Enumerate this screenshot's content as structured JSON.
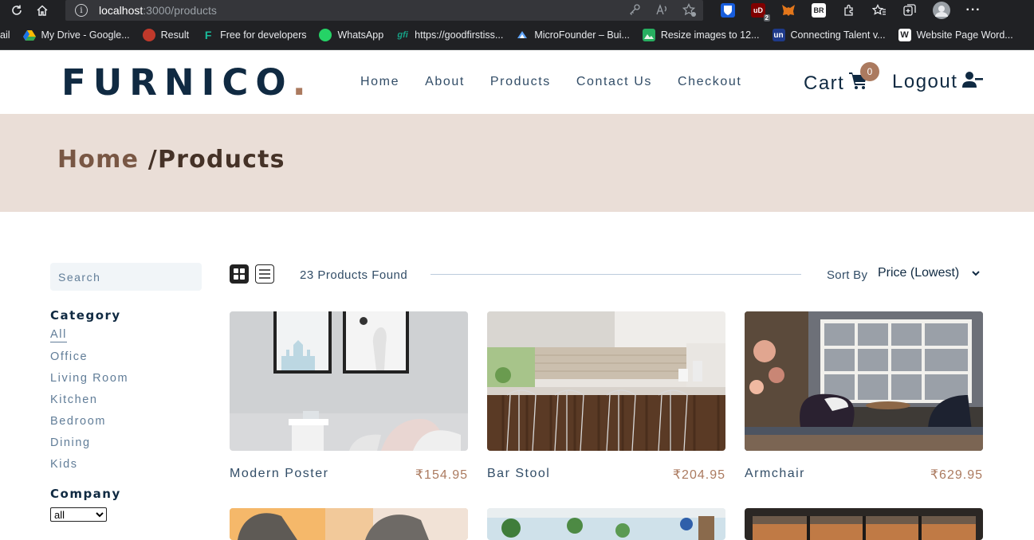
{
  "browser": {
    "url_host": "localhost",
    "url_path": ":3000/products",
    "bookmarks": [
      {
        "label": "ail",
        "color": "#202124"
      },
      {
        "label": "My Drive - Google...",
        "color": "#fbbc04"
      },
      {
        "label": "Result",
        "color": "#c0392b"
      },
      {
        "label": "Free for developers",
        "color": "#1abc9c"
      },
      {
        "label": "WhatsApp",
        "color": "#25d366"
      },
      {
        "label": "https://goodfirstiss...",
        "color": "#16a085"
      },
      {
        "label": "MicroFounder – Bui...",
        "color": "#3b82f6"
      },
      {
        "label": "Resize images to 12...",
        "color": "#27ae60"
      },
      {
        "label": "Connecting Talent v...",
        "color": "#1e3a8a"
      },
      {
        "label": "Website Page Word...",
        "color": "#ffffff"
      }
    ]
  },
  "header": {
    "logo_text": "FURNICO",
    "logo_dot": ".",
    "nav": [
      "Home",
      "About",
      "Products",
      "Contact Us",
      "Checkout"
    ],
    "cart_label": "Cart",
    "cart_count": "0",
    "logout_label": "Logout"
  },
  "hero": {
    "crumb_home": "Home ",
    "crumb_current": "/Products"
  },
  "filters": {
    "search_placeholder": "Search",
    "category_title": "Category",
    "categories": [
      "All",
      "Office",
      "Living Room",
      "Kitchen",
      "Bedroom",
      "Dining",
      "Kids"
    ],
    "company_title": "Company",
    "company_value": "all"
  },
  "sort": {
    "count_text": "23 Products Found",
    "label": "Sort By",
    "value": "Price (Lowest)"
  },
  "products": [
    {
      "name": "Modern Poster",
      "price": "₹154.95"
    },
    {
      "name": "Bar Stool",
      "price": "₹204.95"
    },
    {
      "name": "Armchair",
      "price": "₹629.95"
    }
  ],
  "colors": {
    "primary": "#ab7a5f",
    "dark": "#102a42",
    "hero_bg": "#eaded7"
  }
}
